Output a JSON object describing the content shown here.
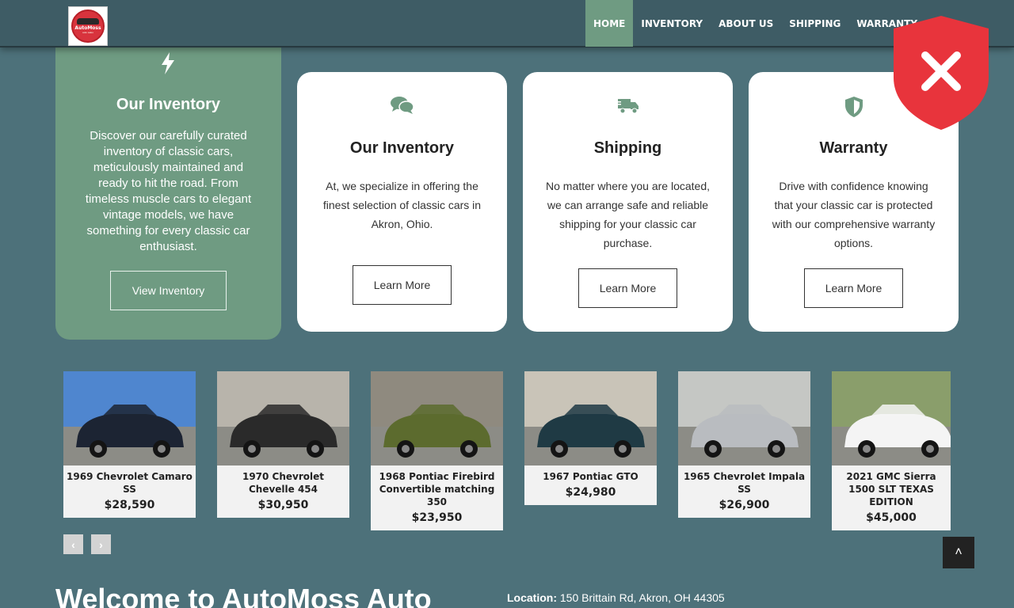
{
  "header": {
    "logo_text": "AutoMoss",
    "logo_subtext": "auto sales",
    "nav": [
      {
        "label": "HOME"
      },
      {
        "label": "INVENTORY"
      },
      {
        "label": "ABOUT US"
      },
      {
        "label": "SHIPPING"
      },
      {
        "label": "WARRANTY"
      },
      {
        "label": "CO"
      }
    ]
  },
  "features": {
    "inventory_highlight": {
      "icon": "bolt-icon",
      "title": "Our Inventory",
      "text": "Discover our carefully curated inventory of classic cars, meticulously maintained and ready to hit the road. From timeless muscle cars to elegant vintage models, we have something for every classic car enthusiast.",
      "button": "View Inventory"
    },
    "cards": [
      {
        "icon": "comments-icon",
        "title": "Our Inventory",
        "text": "At, we specialize in offering the finest selection of classic cars in Akron, Ohio.",
        "button": "Learn More"
      },
      {
        "icon": "truck-icon",
        "title": "Shipping",
        "text": "No matter where you are located, we can arrange safe and reliable shipping for your classic car purchase.",
        "button": "Learn More"
      },
      {
        "icon": "shield-icon",
        "title": "Warranty",
        "text": "Drive with confidence knowing that your classic car is protected with our comprehensive warranty options.",
        "button": "Learn More"
      }
    ]
  },
  "cars": [
    {
      "name": "1969 Chevrolet Camaro SS",
      "price": "$28,590",
      "color": "#1c2433",
      "sky": "#4f86cf"
    },
    {
      "name": "1970 Chevrolet Chevelle 454",
      "price": "$30,950",
      "color": "#2a2a2a",
      "sky": "#b8b4ab"
    },
    {
      "name": "1968 Pontiac Firebird Convertible matching 350",
      "price": "$23,950",
      "color": "#5c6b2e",
      "sky": "#8f8a7f"
    },
    {
      "name": "1967 Pontiac GTO",
      "price": "$24,980",
      "color": "#1f3a44",
      "sky": "#c9c4b8"
    },
    {
      "name": "1965 Chevrolet Impala SS",
      "price": "$26,900",
      "color": "#b9bcc0",
      "sky": "#c5c7c4"
    },
    {
      "name": "2021 GMC Sierra 1500 SLT TEXAS EDITION",
      "price": "$45,000",
      "color": "#f4f4f4",
      "sky": "#8a9e6b"
    }
  ],
  "carousel": {
    "prev": "‹",
    "next": "›"
  },
  "scroll_top": "˄",
  "welcome": {
    "heading": "Welcome to AutoMoss Auto"
  },
  "location": {
    "label": "Location:",
    "value": "150 Brittain Rd, Akron, OH 44305"
  },
  "overlay": {
    "icon": "red-shield-x-icon",
    "color": "#e8343c"
  }
}
